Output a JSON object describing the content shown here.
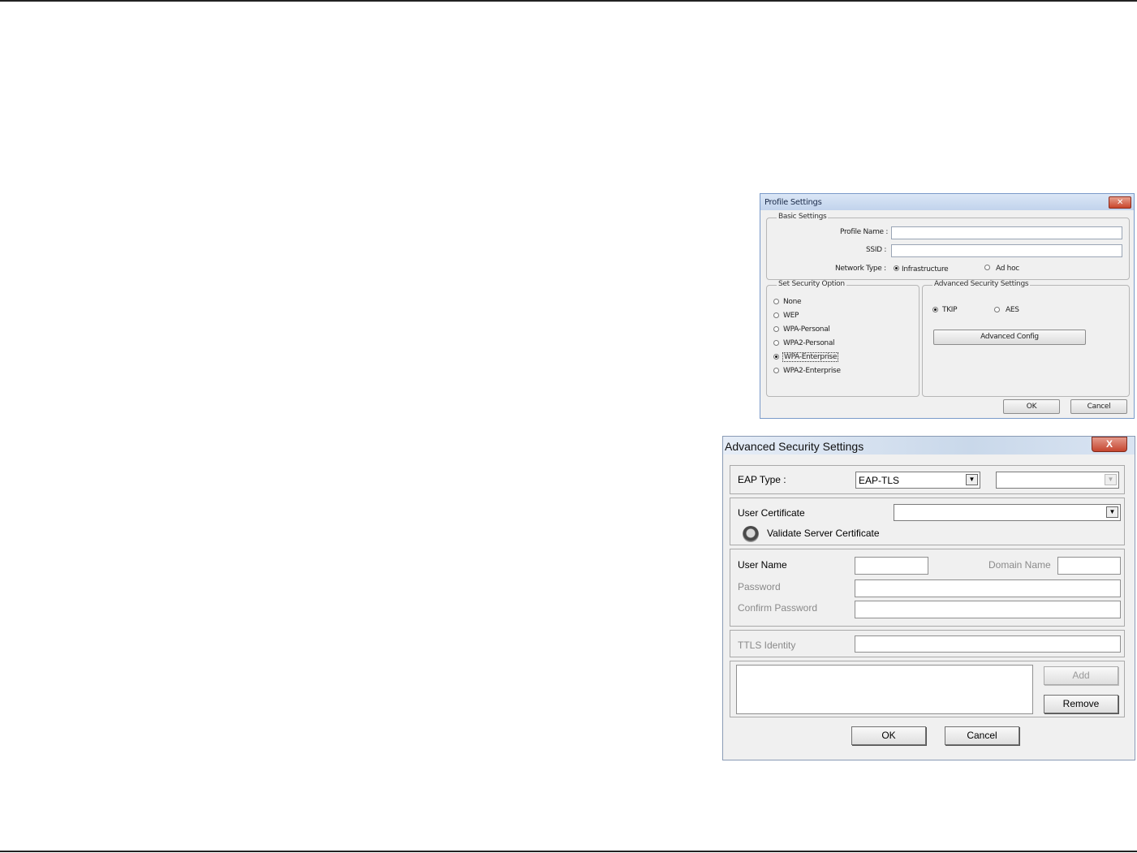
{
  "profile_settings": {
    "title": "Profile Settings",
    "close_glyph": "✕",
    "basic_settings": {
      "legend": "Basic Settings",
      "profile_name_label": "Profile Name :",
      "profile_name_value": "",
      "ssid_label": "SSID :",
      "ssid_value": "",
      "network_type_label": "Network Type :",
      "options": [
        {
          "label": "Infrastructure",
          "selected": true
        },
        {
          "label": "Ad hoc",
          "selected": false
        }
      ]
    },
    "security_option": {
      "legend": "Set Security Option",
      "options": [
        {
          "label": "None",
          "selected": false
        },
        {
          "label": "WEP",
          "selected": false
        },
        {
          "label": "WPA-Personal",
          "selected": false
        },
        {
          "label": "WPA2-Personal",
          "selected": false
        },
        {
          "label": "WPA-Enterprise",
          "selected": true
        },
        {
          "label": "WPA2-Enterprise",
          "selected": false
        }
      ]
    },
    "advanced_security": {
      "legend": "Advanced Security Settings",
      "options": [
        {
          "label": "TKIP",
          "selected": true
        },
        {
          "label": "AES",
          "selected": false
        }
      ],
      "advanced_config_label": "Advanced Config"
    },
    "ok_label": "OK",
    "cancel_label": "Cancel"
  },
  "advanced_security_dialog": {
    "title": "Advanced Security Settings",
    "close_glyph": "X",
    "eap_type_label": "EAP Type :",
    "eap_type_value": "EAP-TLS",
    "eap_inner_value": "",
    "user_certificate_label": "User Certificate",
    "user_certificate_value": "",
    "validate_server_label": "Validate Server Certificate",
    "user_name_label": "User Name",
    "domain_name_label": "Domain Name",
    "password_label": "Password",
    "confirm_password_label": "Confirm Password",
    "ttls_identity_label": "TTLS Identity",
    "add_label": "Add",
    "remove_label": "Remove",
    "ok_label": "OK",
    "cancel_label": "Cancel"
  }
}
